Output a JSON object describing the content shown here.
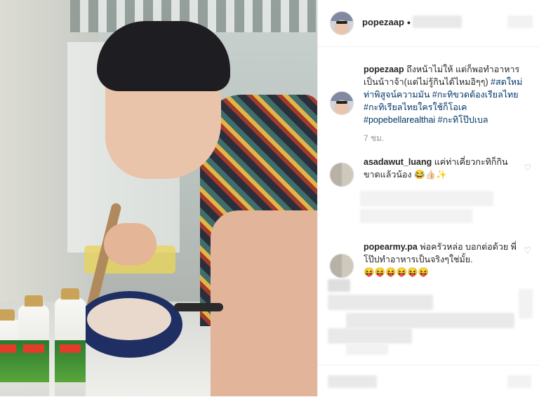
{
  "post": {
    "username": "popezaap",
    "separator": "•",
    "caption_user": "popezaap",
    "caption_text": "ถึงหน้าไม่ให้ แต่ก็พอทำอาหารเป็นน้าาจ้า(แต่ไม่รู้กินได้ไหมอิๆๆ)",
    "hashtags": "#สดใหม่ท่าพิสูจน์ความมัน #กะทิขวดต้องเรียลไทย #กะทิเรียลไทยใครใช้ก็โอเค #popebellarealthai #กะทิโป๊ปเบล",
    "time": "7 ชม."
  },
  "comments": [
    {
      "user": "asadawut_luang",
      "text": "แค่ท่าเคี่ยวกะทิก็กินขาดแล้วน้อง 😂👍🏻✨",
      "heart": "♡"
    },
    {
      "user": "popearmy.pa",
      "text": "พ่อครัวหล่อ บอกต่อด้วย พี่โป๊ปทำอาหารเป็นจริงๆใช่มั้ย.",
      "emojis": "😝😝😝😝😝😝",
      "heart": "♡"
    }
  ],
  "icons": {
    "avatar": "profile-avatar",
    "heart": "heart-icon"
  },
  "colors": {
    "hashtag": "#003569",
    "text": "#262626",
    "muted": "#999999"
  }
}
